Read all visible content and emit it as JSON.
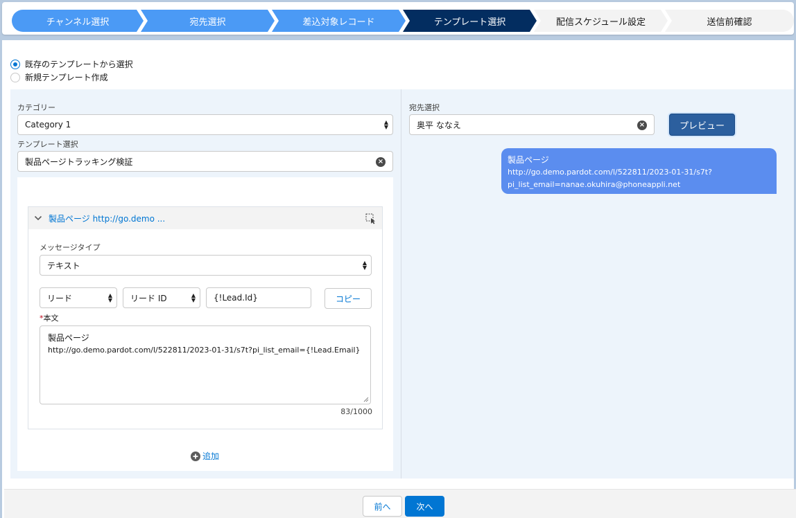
{
  "steps": [
    {
      "label": "チャンネル選択",
      "state": "done"
    },
    {
      "label": "宛先選択",
      "state": "done"
    },
    {
      "label": "差込対象レコード",
      "state": "done"
    },
    {
      "label": "テンプレート選択",
      "state": "current"
    },
    {
      "label": "配信スケジュール設定",
      "state": "todo"
    },
    {
      "label": "送信前確認",
      "state": "todo"
    }
  ],
  "template_mode": {
    "existing_label": "既存のテンプレートから選択",
    "new_label": "新規テンプレート作成",
    "selected": "existing"
  },
  "left": {
    "category_label": "カテゴリー",
    "category_value": "Category 1",
    "template_label": "テンプレート選択",
    "template_value": "製品ページトラッキング検証",
    "section_title": "製品ページ http://go.demo ...",
    "message_type_label": "メッセージタイプ",
    "message_type_value": "テキスト",
    "object_value": "リード",
    "field_value": "リード ID",
    "merge_tag_value": "{!Lead.Id}",
    "copy_label": "コピー",
    "required_mark": "*",
    "body_label": "本文",
    "body_line1": "製品ページ",
    "body_line2": "http://go.demo.pardot.com/l/522811/2023-01-31/s7t?pi_list_email={!Lead.Email}",
    "char_count": "83/1000",
    "add_label": "追加"
  },
  "right": {
    "recipient_label": "宛先選択",
    "recipient_value": "奥平 ななえ",
    "preview_label": "プレビュー",
    "preview_line1": "製品ページ",
    "preview_line2": "http://go.demo.pardot.com/l/522811/2023-01-31/s7t?",
    "preview_line3": "pi_list_email=nanae.okuhira@phoneappli.net"
  },
  "footer": {
    "prev_label": "前へ",
    "next_label": "次へ"
  },
  "colors": {
    "step_done": "#4b9af5",
    "step_current": "#032d60",
    "step_todo": "#f3f3f3",
    "brand": "#0176d3",
    "preview_button": "#2c5f9e",
    "bubble": "#5b8def"
  },
  "icons": {
    "section_toggle": "chevron-down-icon",
    "section_action": "select-cursor-icon",
    "clear": "clear-icon",
    "add": "add-circle-icon"
  }
}
